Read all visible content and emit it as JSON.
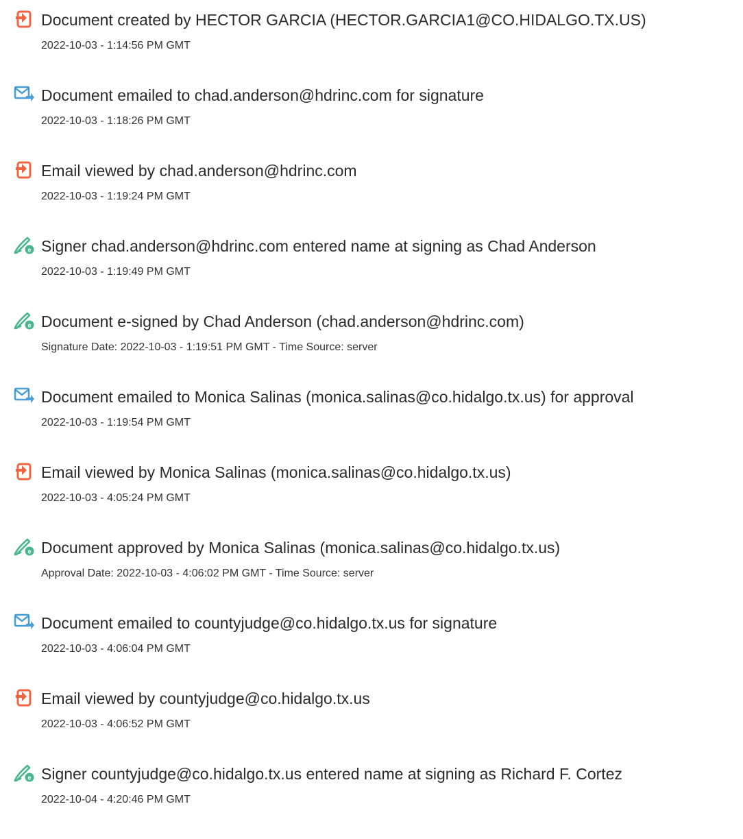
{
  "colors": {
    "text": "#2b2b2b",
    "doc_icon": "#f0653f",
    "email_icon": "#4a9fd6",
    "sign_icon": "#4ab58e"
  },
  "events": [
    {
      "icon": "document-icon",
      "title": "Document created by HECTOR GARCIA (HECTOR.GARCIA1@CO.HIDALGO.TX.US)",
      "detail": "2022-10-03 - 1:14:56 PM GMT"
    },
    {
      "icon": "email-sent-icon",
      "title": "Document emailed to chad.anderson@hdrinc.com for signature",
      "detail": "2022-10-03 - 1:18:26 PM GMT"
    },
    {
      "icon": "document-icon",
      "title": "Email viewed by chad.anderson@hdrinc.com",
      "detail": "2022-10-03 - 1:19:24 PM GMT"
    },
    {
      "icon": "signature-pen-icon",
      "title": "Signer chad.anderson@hdrinc.com entered name at signing as Chad Anderson",
      "detail": "2022-10-03 - 1:19:49 PM GMT"
    },
    {
      "icon": "signature-pen-icon",
      "title": "Document e-signed by Chad Anderson (chad.anderson@hdrinc.com)",
      "detail": "Signature Date: 2022-10-03 - 1:19:51 PM GMT - Time Source: server"
    },
    {
      "icon": "email-sent-icon",
      "title": "Document emailed to Monica Salinas (monica.salinas@co.hidalgo.tx.us) for approval",
      "detail": "2022-10-03 - 1:19:54 PM GMT"
    },
    {
      "icon": "document-icon",
      "title": "Email viewed by Monica Salinas (monica.salinas@co.hidalgo.tx.us)",
      "detail": "2022-10-03 - 4:05:24 PM GMT"
    },
    {
      "icon": "signature-pen-icon",
      "title": "Document approved by Monica Salinas (monica.salinas@co.hidalgo.tx.us)",
      "detail": "Approval Date: 2022-10-03 - 4:06:02 PM GMT - Time Source: server"
    },
    {
      "icon": "email-sent-icon",
      "title": "Document emailed to countyjudge@co.hidalgo.tx.us for signature",
      "detail": "2022-10-03 - 4:06:04 PM GMT"
    },
    {
      "icon": "document-icon",
      "title": "Email viewed by countyjudge@co.hidalgo.tx.us",
      "detail": "2022-10-03 - 4:06:52 PM GMT"
    },
    {
      "icon": "signature-pen-icon",
      "title": "Signer countyjudge@co.hidalgo.tx.us entered name at signing as Richard F. Cortez",
      "detail": "2022-10-04 - 4:20:46 PM GMT"
    }
  ]
}
